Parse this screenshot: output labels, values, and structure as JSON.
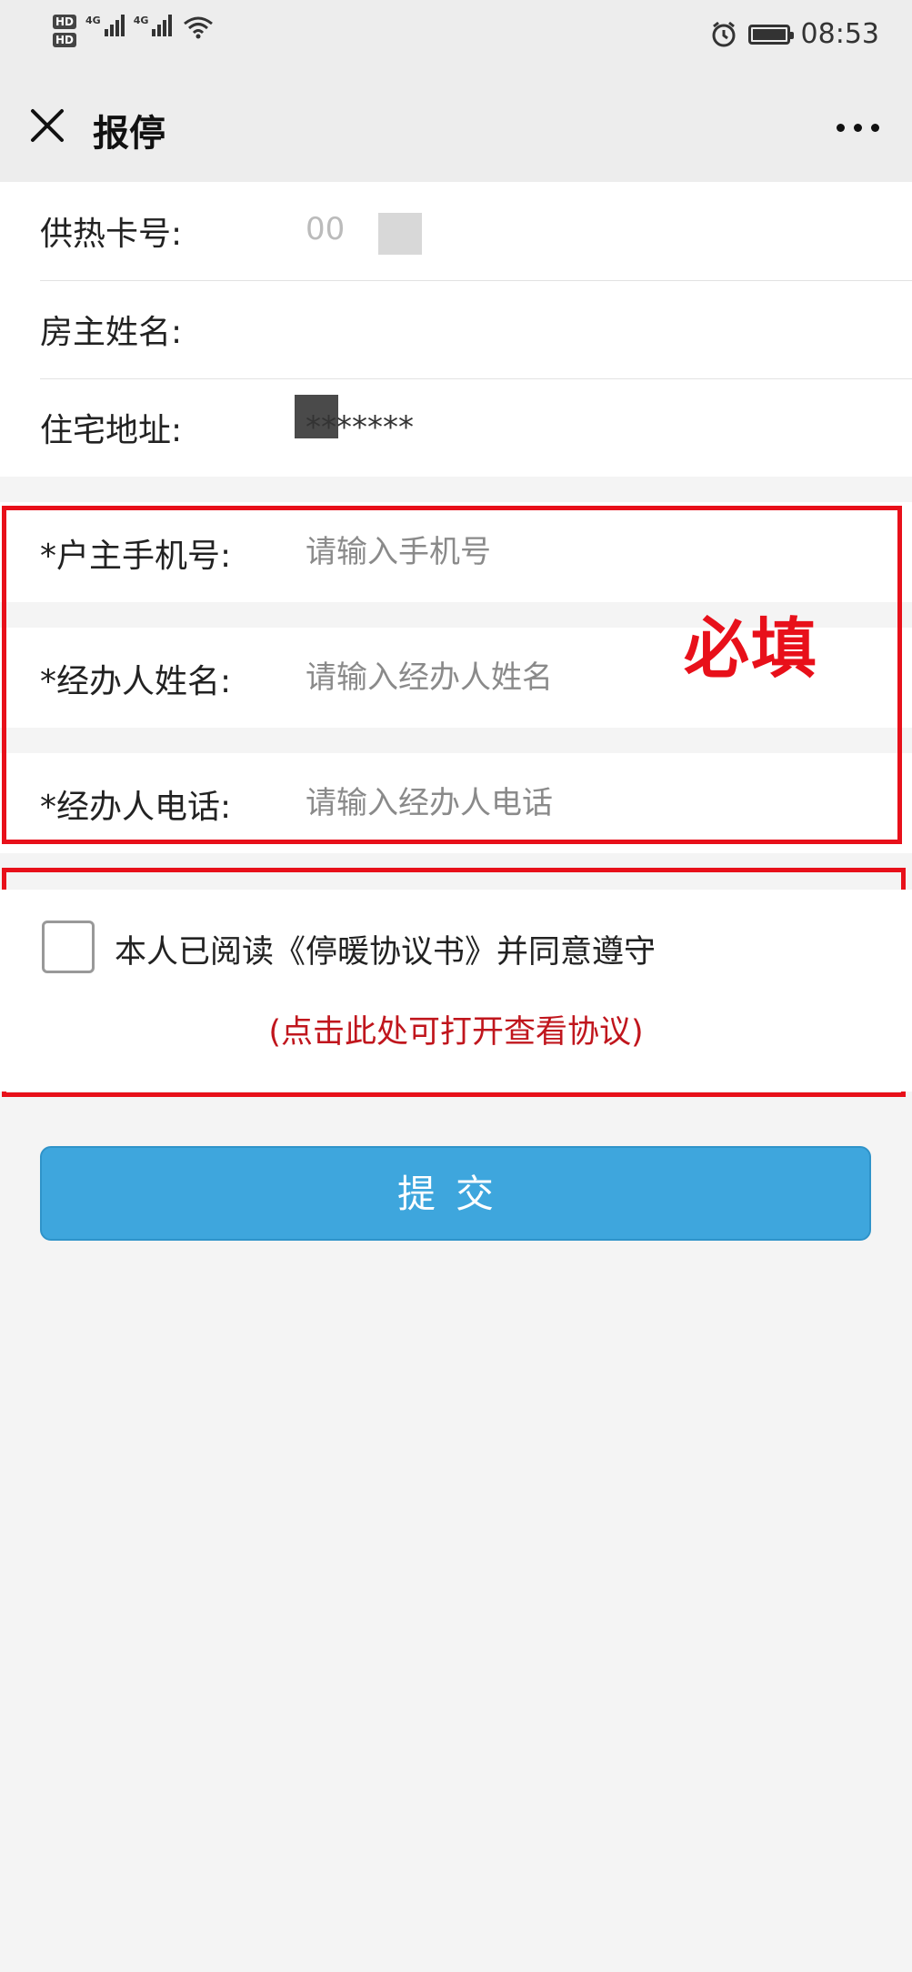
{
  "status_bar": {
    "hd1": "HD",
    "hd2": "HD",
    "net1": "4G",
    "net2": "4G",
    "time": "08:53"
  },
  "nav": {
    "title": "报停"
  },
  "info": {
    "card_label": "供热卡号:",
    "card_value": "00",
    "owner_label": "房主姓名:",
    "address_label": "住宅地址:",
    "address_value": "*******"
  },
  "form": {
    "phone_label": "*户主手机号:",
    "phone_placeholder": "请输入手机号",
    "agent_name_label": "*经办人姓名:",
    "agent_name_placeholder": "请输入经办人姓名",
    "agent_phone_label": "*经办人电话:",
    "agent_phone_placeholder": "请输入经办人电话",
    "required_note": "必填"
  },
  "agreement": {
    "text": "本人已阅读《停暖协议书》并同意遵守",
    "link": "(点击此处可打开查看协议)",
    "checked": false
  },
  "submit_label": "提交",
  "colors": {
    "annotation_red": "#e8101a",
    "submit_blue": "#3ea6dd",
    "link_red": "#c0161d"
  }
}
